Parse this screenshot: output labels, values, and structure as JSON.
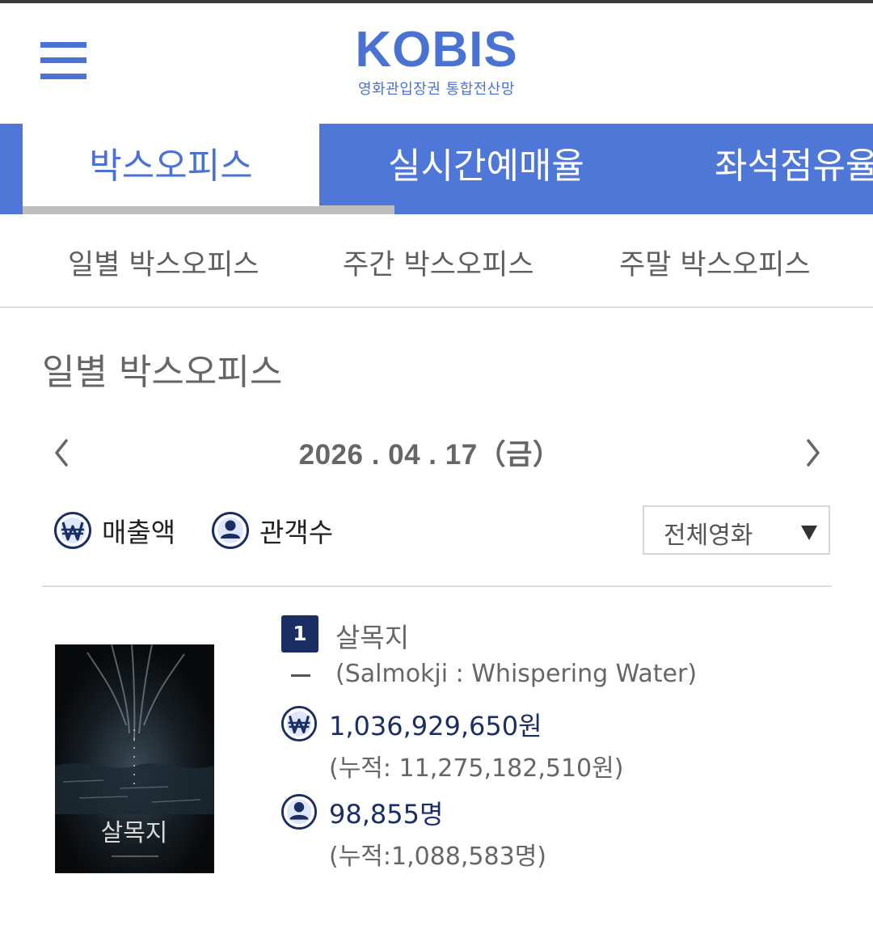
{
  "header": {
    "logo": "KOBIS",
    "logo_subtitle": "영화관입장권 통합전산망"
  },
  "tabs": [
    {
      "label": "박스오피스",
      "active": true
    },
    {
      "label": "실시간예매율",
      "active": false
    },
    {
      "label": "좌석점유율",
      "active": false
    }
  ],
  "subtabs": [
    "일별 박스오피스",
    "주간 박스오피스",
    "주말 박스오피스"
  ],
  "page_title": "일별 박스오피스",
  "date": "2026 . 04 . 17（금）",
  "filters": {
    "sales_label": "매출액",
    "audience_label": "관객수",
    "select_value": "전체영화"
  },
  "movie": {
    "rank": "1",
    "rank_change": "–",
    "title_ko": "살목지",
    "title_en": "(Salmokji : Whispering Water)",
    "sales": "1,036,929,650원",
    "sales_cumulative": "(누적: 11,275,182,510원)",
    "audience": "98,855명",
    "audience_cumulative": "(누적:1,088,583명)",
    "poster_title": "살목지"
  },
  "colors": {
    "brand_blue": "#4a72d4",
    "tab_blue": "#4f77d8",
    "navy": "#1b2e64"
  }
}
